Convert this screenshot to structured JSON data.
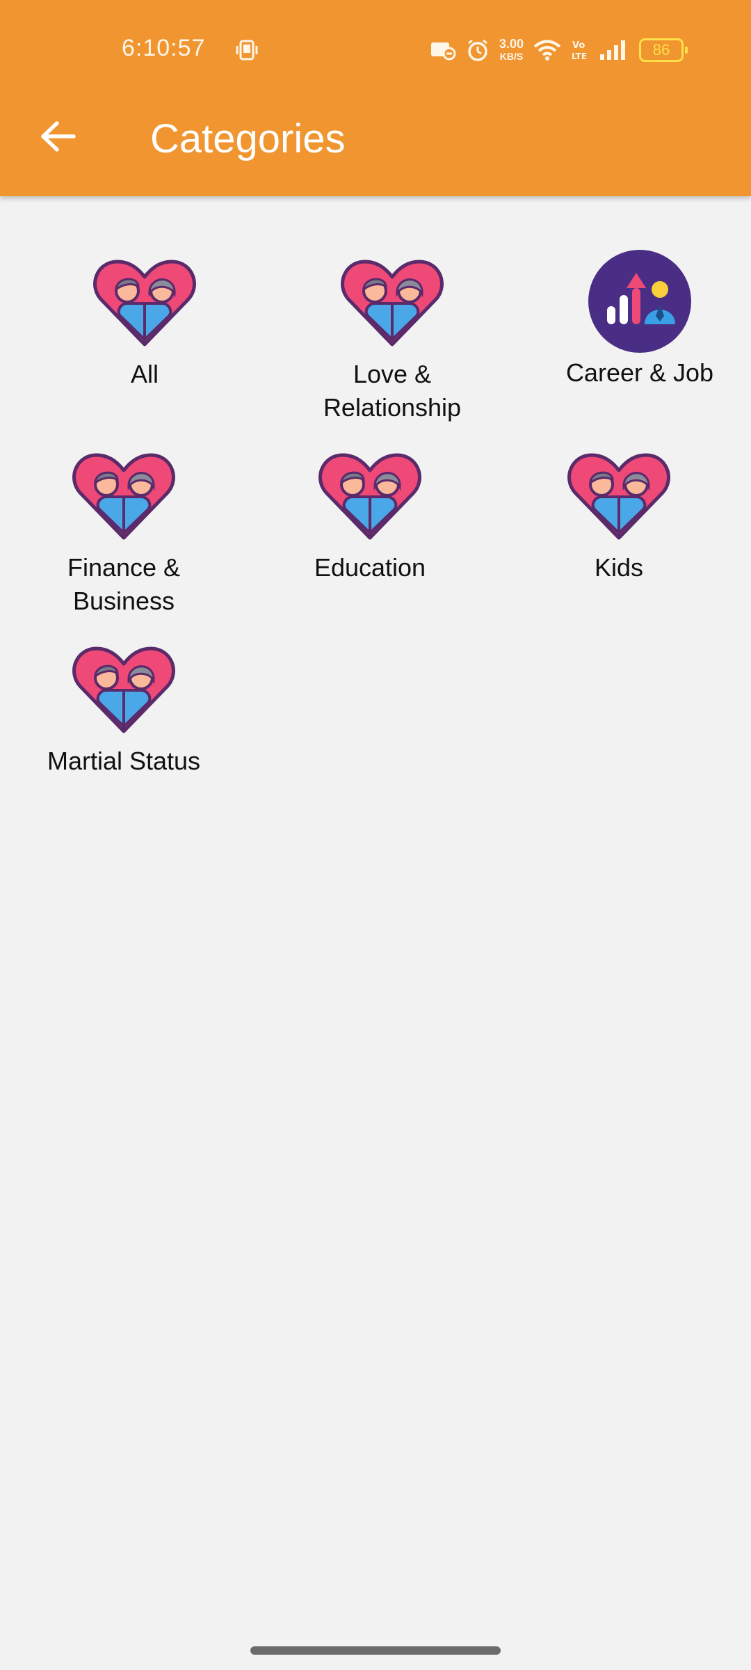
{
  "status_bar": {
    "time": "6:10:57",
    "net_speed_value": "3.00",
    "net_speed_unit": "KB/S",
    "volte_label": "Vo LTE",
    "battery_level": "86"
  },
  "app_bar": {
    "title": "Categories",
    "back_icon": "arrow-left-icon",
    "background_color": "#f0952f"
  },
  "categories": [
    {
      "label_lines": [
        "All"
      ],
      "icon": "couple-heart-icon"
    },
    {
      "label_lines": [
        "Love &",
        "Relationship"
      ],
      "icon": "couple-heart-icon"
    },
    {
      "label_lines": [
        "Career & Job"
      ],
      "icon": "career-growth-icon"
    },
    {
      "label_lines": [
        "Finance &",
        "Business"
      ],
      "icon": "couple-heart-icon"
    },
    {
      "label_lines": [
        "Education"
      ],
      "icon": "couple-heart-icon"
    },
    {
      "label_lines": [
        "Kids"
      ],
      "icon": "couple-heart-icon"
    },
    {
      "label_lines": [
        "Martial Status"
      ],
      "icon": "couple-heart-icon"
    }
  ]
}
